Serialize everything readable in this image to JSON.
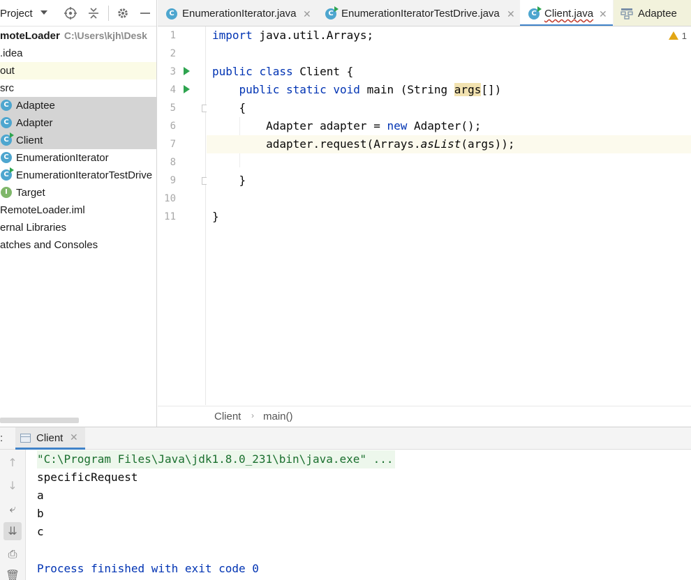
{
  "project_panel": {
    "title": "Project",
    "tree": [
      {
        "label": "moteLoader",
        "path": "C:\\Users\\kjh\\Desk",
        "kind": "root"
      },
      {
        "label": ".idea",
        "kind": "folder"
      },
      {
        "label": "out",
        "kind": "folder",
        "state": "excluded"
      },
      {
        "label": "src",
        "kind": "folder"
      },
      {
        "label": "Adaptee",
        "kind": "class",
        "selected": true
      },
      {
        "label": "Adapter",
        "kind": "class",
        "selected": true
      },
      {
        "label": "Client",
        "kind": "class-runnable",
        "selected": true
      },
      {
        "label": "EnumerationIterator",
        "kind": "class"
      },
      {
        "label": "EnumerationIteratorTestDrive",
        "kind": "class-runnable"
      },
      {
        "label": "Target",
        "kind": "interface"
      },
      {
        "label": "RemoteLoader.iml",
        "kind": "file"
      },
      {
        "label": "ernal Libraries",
        "kind": "library"
      },
      {
        "label": "atches and Consoles",
        "kind": "scratch"
      }
    ]
  },
  "editor": {
    "tabs": [
      {
        "label": "EnumerationIterator.java",
        "icon": "class-icon",
        "closable": true
      },
      {
        "label": "EnumerationIteratorTestDrive.java",
        "icon": "class-runnable-icon",
        "closable": true
      },
      {
        "label": "Client.java",
        "icon": "class-runnable-icon",
        "closable": true,
        "active": true
      },
      {
        "label": "Adaptee",
        "icon": "diagram-icon",
        "closable": false
      }
    ],
    "line_numbers": [
      "1",
      "2",
      "3",
      "4",
      "5",
      "6",
      "7",
      "8",
      "9",
      "10",
      "11"
    ],
    "code": {
      "l1_kw": "import",
      "l1_rest": " java.util.Arrays;",
      "l3_kw1": "public",
      "l3_kw2": "class",
      "l3_rest": " Client {",
      "l4_kw1": "public",
      "l4_kw2": "static",
      "l4_kw3": "void",
      "l4_a": " main (String ",
      "l4_param": "args",
      "l4_b": "[])",
      "l5": "{",
      "l6_a": "Adapter adapter = ",
      "l6_kw": "new",
      "l6_b": " Adapter();",
      "l7_a": "adapter.request(Arrays.",
      "l7_static": "asList",
      "l7_b": "(args));",
      "l9": "}",
      "l11": "}"
    },
    "warnings_count": "1",
    "current_line": 7,
    "breadcrumb": [
      "Client",
      "main()"
    ]
  },
  "run_panel": {
    "prefix": ":",
    "tab_label": "Client",
    "output": [
      {
        "text": "\"C:\\Program Files\\Java\\jdk1.8.0_231\\bin\\java.exe\" ...",
        "kind": "cmd"
      },
      {
        "text": "specificRequest",
        "kind": "out"
      },
      {
        "text": "a",
        "kind": "out"
      },
      {
        "text": "b",
        "kind": "out"
      },
      {
        "text": "c",
        "kind": "out"
      },
      {
        "text": "",
        "kind": "out"
      },
      {
        "text": "Process finished with exit code 0",
        "kind": "sys"
      }
    ]
  },
  "colors": {
    "keyword": "#0033b3",
    "selection": "#d4d4d4",
    "current_line": "#fcfaed",
    "active_tab_underline": "#4083c9",
    "run_gutter": "#2ea44f",
    "class_icon": "#4ea6cf",
    "interface_icon": "#7fb76a",
    "warning": "#e2a614"
  }
}
